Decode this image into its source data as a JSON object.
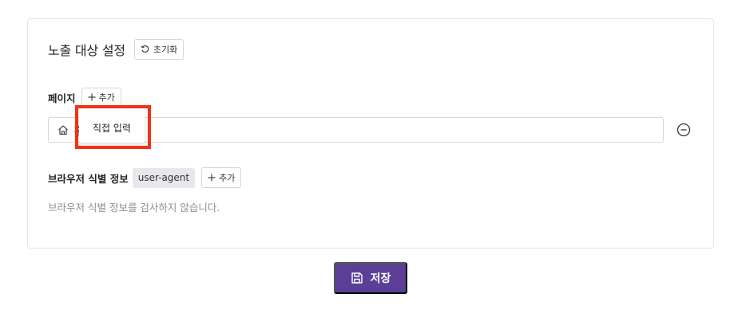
{
  "header": {
    "title": "노출 대상 설정",
    "reset_label": "초기화"
  },
  "page_section": {
    "label": "페이지",
    "add_label": "추가",
    "input_value": "홈",
    "dropdown_option": "직접 입력"
  },
  "browser_section": {
    "label": "브라우저 식별 정보",
    "tag": "user-agent",
    "add_label": "추가",
    "hint": "브라우저 식별 정보를 검사하지 않습니다."
  },
  "footer": {
    "save_label": "저장"
  },
  "colors": {
    "primary": "#5b3f96",
    "highlight": "#f03218",
    "hint_text": "#8b9098",
    "tag_bg": "#e7e8ec"
  },
  "icons": {
    "reset": "reset-icon",
    "add": "plus-icon",
    "home": "home-icon",
    "remove": "minus-circle-icon",
    "save": "save-icon"
  }
}
